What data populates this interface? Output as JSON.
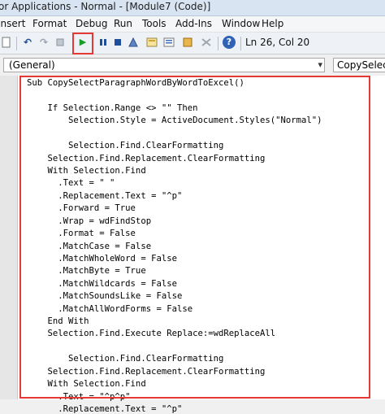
{
  "window": {
    "title": "or Applications - Normal - [Module7 (Code)]"
  },
  "menu": {
    "items": [
      "Insert",
      "Format",
      "Debug",
      "Run",
      "Tools",
      "Add-Ins",
      "Window",
      "Help"
    ]
  },
  "toolbar": {
    "cursor_position": "Ln 26, Col 20",
    "icons": [
      "undo-icon",
      "redo-icon",
      "run-icon",
      "break-icon",
      "reset-icon",
      "design-mode-icon",
      "project-explorer-icon",
      "properties-icon",
      "object-browser-icon",
      "toolbox-icon",
      "help-icon"
    ],
    "run_symbol": "▶",
    "help_symbol": "?",
    "undo_symbol": "↶",
    "redo_symbol": "↷"
  },
  "dropdowns": {
    "object": "(General)",
    "procedure": "CopySelectP"
  },
  "code": {
    "lines": [
      "Sub CopySelectParagraphWordByWordToExcel()",
      "",
      "    If Selection.Range <> \"\" Then",
      "        Selection.Style = ActiveDocument.Styles(\"Normal\")",
      "",
      "        Selection.Find.ClearFormatting",
      "    Selection.Find.Replacement.ClearFormatting",
      "    With Selection.Find",
      "      .Text = \" \"",
      "      .Replacement.Text = \"^p\"",
      "      .Forward = True",
      "      .Wrap = wdFindStop",
      "      .Format = False",
      "      .MatchCase = False",
      "      .MatchWholeWord = False",
      "      .MatchByte = True",
      "      .MatchWildcards = False",
      "      .MatchSoundsLike = False",
      "      .MatchAllWordForms = False",
      "    End With",
      "    Selection.Find.Execute Replace:=wdReplaceAll",
      "",
      "        Selection.Find.ClearFormatting",
      "    Selection.Find.Replacement.ClearFormatting",
      "    With Selection.Find",
      "      .Text = \"^p^p\"",
      "      .Replacement.Text = \"^p\""
    ]
  }
}
